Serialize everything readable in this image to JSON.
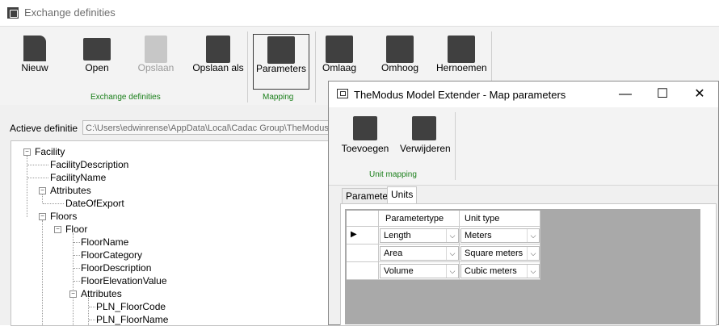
{
  "window": {
    "title": "Exchange definities"
  },
  "ribbon": {
    "buttons": [
      {
        "label": "Nieuw"
      },
      {
        "label": "Open"
      },
      {
        "label": "Opslaan"
      },
      {
        "label": "Opslaan als"
      },
      {
        "label": "Parameters"
      },
      {
        "label": "Omlaag"
      },
      {
        "label": "Omhoog"
      },
      {
        "label": "Hernoemen"
      }
    ],
    "groups": [
      "Exchange definities",
      "Mapping"
    ]
  },
  "definition": {
    "label": "Actieve definitie",
    "value": "C:\\Users\\edwinrense\\AppData\\Local\\Cadac Group\\TheModus"
  },
  "tree": {
    "nodes": [
      {
        "label": "Facility"
      },
      {
        "label": "FacilityDescription"
      },
      {
        "label": "FacilityName"
      },
      {
        "label": "Attributes"
      },
      {
        "label": "DateOfExport"
      },
      {
        "label": "Floors"
      },
      {
        "label": "Floor"
      },
      {
        "label": "FloorName"
      },
      {
        "label": "FloorCategory"
      },
      {
        "label": "FloorDescription"
      },
      {
        "label": "FloorElevationValue"
      },
      {
        "label": "Attributes"
      },
      {
        "label": "PLN_FloorCode"
      },
      {
        "label": "PLN_FloorName"
      }
    ]
  },
  "dialog": {
    "title": "TheModus Model Extender - Map parameters",
    "buttons": [
      {
        "label": "Toevoegen"
      },
      {
        "label": "Verwijderen"
      }
    ],
    "group": "Unit mapping",
    "tabs": [
      "Parameter",
      "Units"
    ],
    "grid": {
      "headers": [
        "Parametertype",
        "Unit type"
      ],
      "rows": [
        {
          "param": "Length",
          "unit": "Meters"
        },
        {
          "param": "Area",
          "unit": "Square meters"
        },
        {
          "param": "Volume",
          "unit": "Cubic meters"
        }
      ]
    }
  }
}
